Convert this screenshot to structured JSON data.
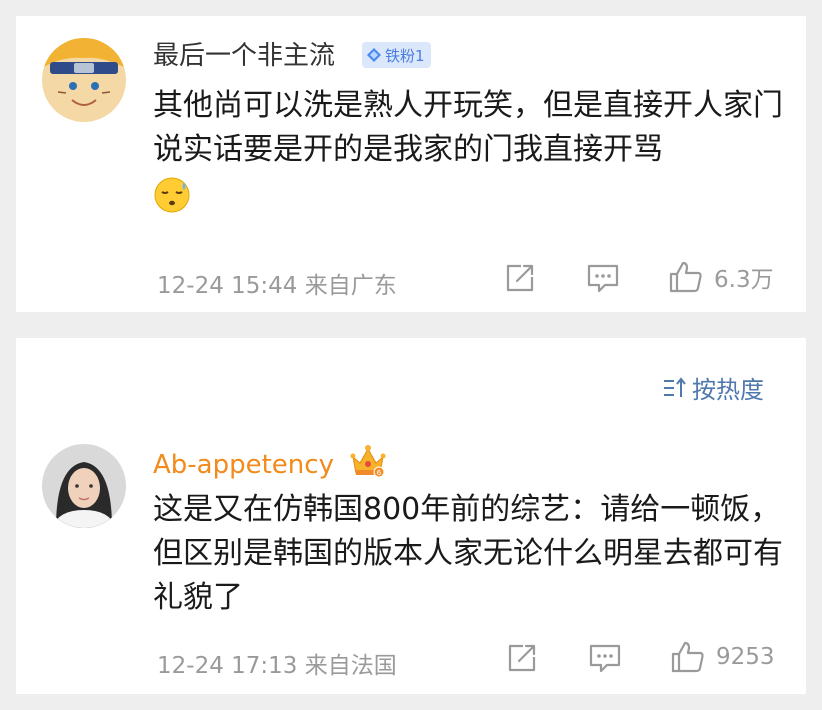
{
  "comments": [
    {
      "username": "最后一个非主流",
      "badge": "铁粉1",
      "text": "其他尚可以洗是熟人开玩笑，但是直接开人家门说实话要是开的是我家的门我直接开骂",
      "emoji": "cold-sweat-emoji",
      "time": "12-24 15:44",
      "location": "来自广东",
      "likes": "6.3万"
    },
    {
      "username": "Ab-appetency",
      "badge_icon": "crown-icon",
      "text": "这是又在仿韩国800年前的综艺：请给一顿饭，但区别是韩国的版本人家无论什么明星去都可有礼貌了",
      "time": "12-24 17:13",
      "location": "来自法国",
      "likes": "9253"
    }
  ],
  "sort": {
    "label": "按热度",
    "icon": "sort-icon"
  },
  "colors": {
    "username": "#333333",
    "vip_username": "#f28a1c",
    "meta": "#9a9a9a",
    "sort": "#4f78ad",
    "badge_bg": "#dbe7fa",
    "badge_text": "#4a7ee0"
  }
}
